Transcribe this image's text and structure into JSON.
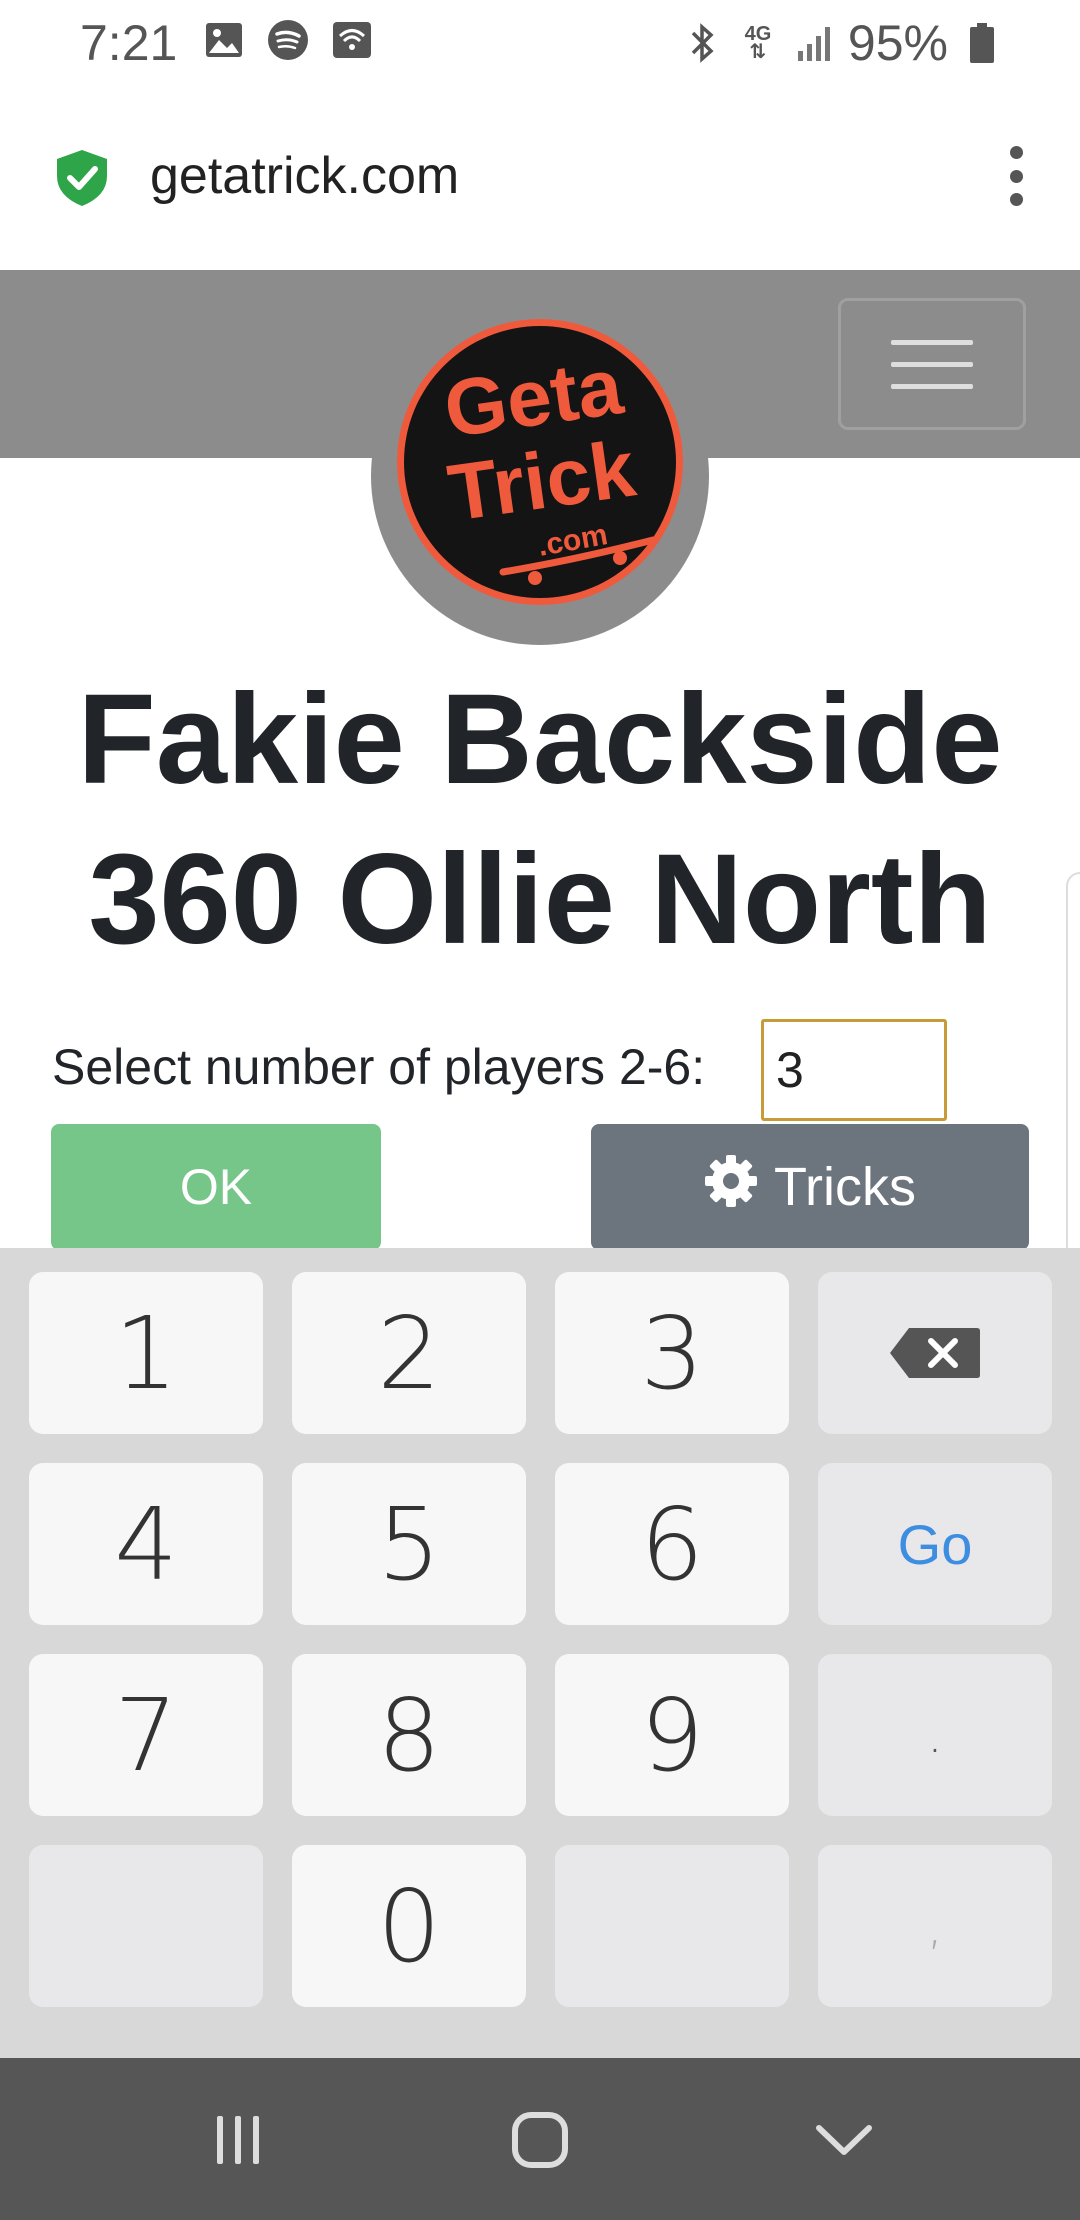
{
  "status_bar": {
    "time": "7:21",
    "battery": "95%",
    "network": "4G",
    "icons_left": [
      "image-icon",
      "spotify-icon",
      "wifi-calling-icon"
    ],
    "icons_right": [
      "bluetooth-icon",
      "network-4g-icon",
      "signal-icon",
      "battery-icon"
    ]
  },
  "browser": {
    "url": "getatrick.com",
    "secure_icon": "shield-check-icon",
    "menu_icon": "kebab-menu-icon"
  },
  "site": {
    "logo_text_line1": "Geta",
    "logo_text_line2": "Trick",
    "logo_text_line3": ".com",
    "menu_icon": "hamburger-icon"
  },
  "main": {
    "trick_line1": "Fakie Backside",
    "trick_line2": "360 Ollie North",
    "players_label": "Select number of players 2-6:",
    "players_value": "3",
    "ok_label": "OK",
    "tricks_label": "Tricks",
    "tricks_icon": "gear-icon"
  },
  "keyboard": {
    "rows": [
      [
        "1",
        "2",
        "3",
        "⌫"
      ],
      [
        "4",
        "5",
        "6",
        "Go"
      ],
      [
        "7",
        "8",
        "9",
        "."
      ],
      [
        "",
        "0",
        "",
        ","
      ]
    ]
  },
  "nav_bar": {
    "icons": [
      "recents-icon",
      "home-icon",
      "back-icon"
    ]
  },
  "colors": {
    "ok_button": "#77c689",
    "tricks_button": "#6c757d",
    "header_bg": "#8c8c8c",
    "logo_orange": "#f05a3c",
    "go_key": "#3d8de0",
    "input_border": "#c79a3a"
  }
}
